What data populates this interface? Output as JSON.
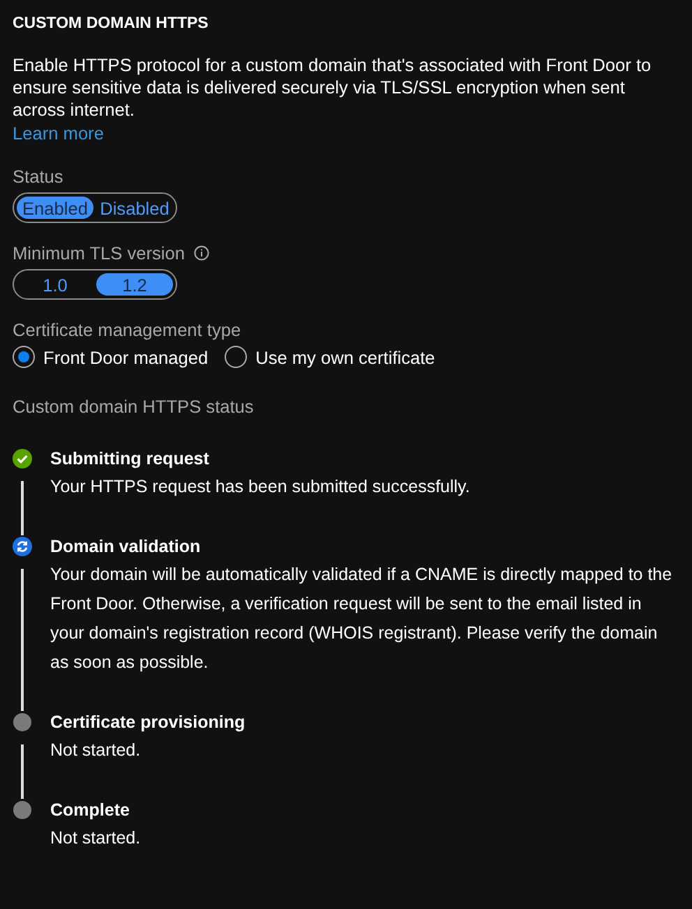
{
  "title": "CUSTOM DOMAIN HTTPS",
  "description": "Enable HTTPS protocol for a custom domain that's associated with Front Door to ensure sensitive data is delivered securely via TLS/SSL encryption when sent across internet.",
  "learn_more": "Learn more",
  "status": {
    "label": "Status",
    "options": [
      {
        "label": "Enabled",
        "selected": true
      },
      {
        "label": "Disabled",
        "selected": false
      }
    ]
  },
  "tls": {
    "label": "Minimum TLS version",
    "options": [
      {
        "label": "1.0",
        "selected": false
      },
      {
        "label": "1.2",
        "selected": true
      }
    ]
  },
  "certificate": {
    "label": "Certificate management type",
    "options": [
      {
        "label": "Front Door managed",
        "selected": true
      },
      {
        "label": "Use my own certificate",
        "selected": false
      }
    ]
  },
  "https_status": {
    "label": "Custom domain HTTPS status",
    "steps": [
      {
        "kind": "done",
        "title": "Submitting request",
        "text": "Your HTTPS request has been submitted successfully."
      },
      {
        "kind": "in_progress",
        "title": "Domain validation",
        "text": "Your domain will be automatically validated if a CNAME is directly mapped to the Front Door. Otherwise, a verification request will be sent to the email listed in your domain's registration record (WHOIS registrant). Please verify the domain as soon as possible."
      },
      {
        "kind": "not_started",
        "title": "Certificate provisioning",
        "text": "Not started."
      },
      {
        "kind": "not_started",
        "title": "Complete",
        "text": "Not started."
      }
    ]
  }
}
